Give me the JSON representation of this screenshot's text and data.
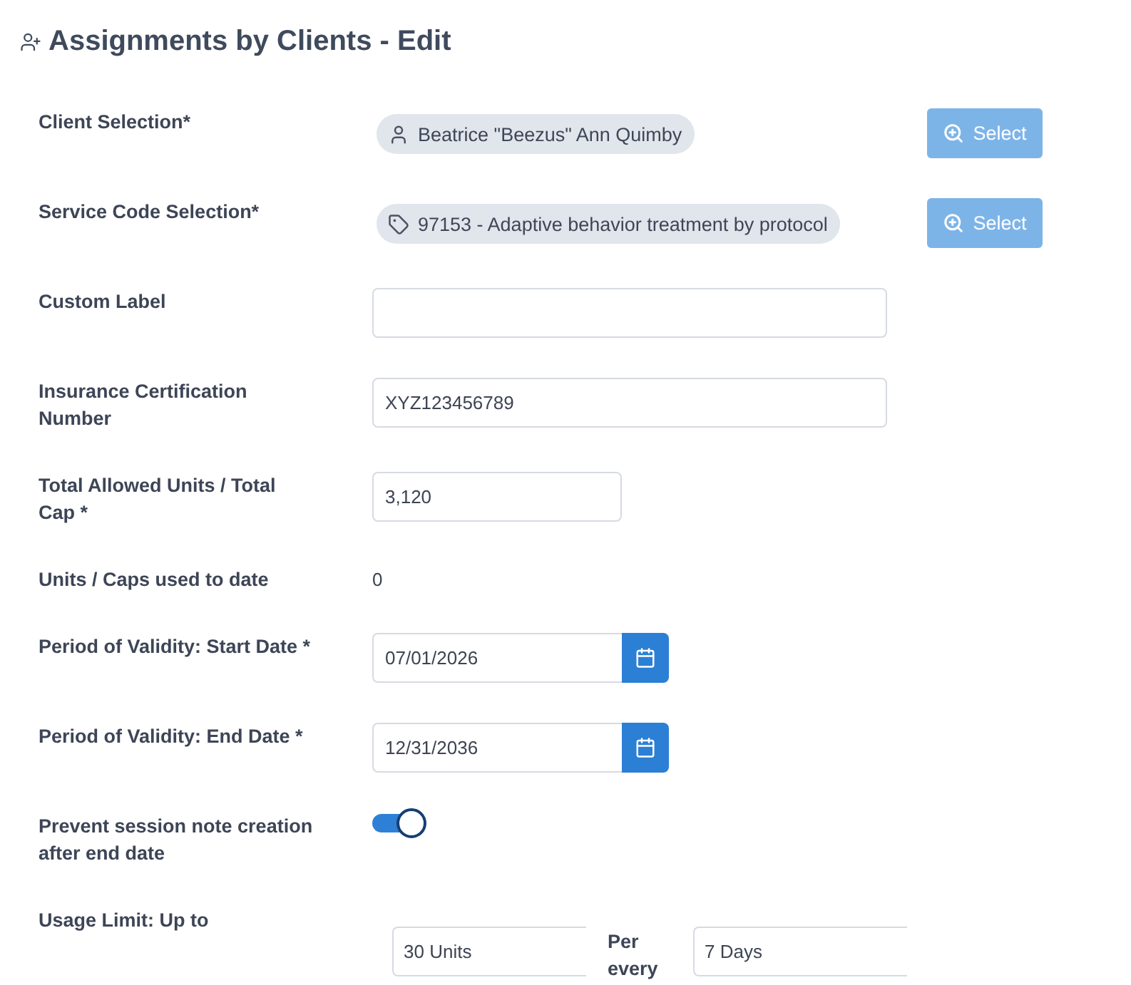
{
  "page": {
    "title": "Assignments by Clients - Edit"
  },
  "fields": [
    {
      "kind": "selection",
      "label": "Client Selection*",
      "chip": {
        "kind": "person",
        "text": "Beatrice \"Beezus\" Ann Quimby"
      },
      "button": "Select"
    },
    {
      "kind": "selection",
      "label": "Service Code Selection*",
      "chip": {
        "kind": "tag",
        "text": "97153 - Adaptive behavior treatment by protocol"
      },
      "button": "Select"
    },
    {
      "kind": "text",
      "label": "Custom Label"
    },
    {
      "kind": "text",
      "label": "Insurance Certification Number",
      "value": "XYZ123456789"
    },
    {
      "kind": "number",
      "label": "Total Allowed Units / Total Cap *",
      "value": "3,120"
    },
    {
      "kind": "static",
      "label": "Units / Caps used to date",
      "value": "0"
    },
    {
      "kind": "date",
      "label": "Period of Validity: Start Date *",
      "value": "07/01/2026"
    },
    {
      "kind": "date",
      "label": "Period of Validity: End Date *",
      "value": "12/31/2036"
    },
    {
      "kind": "toggle",
      "label": "Prevent session note creation after end date",
      "on": true
    },
    {
      "kind": "usage",
      "label": "Usage Limit: Up to",
      "amount": "30 Units",
      "per_label": "Per every",
      "period": "7 Days"
    }
  ]
}
